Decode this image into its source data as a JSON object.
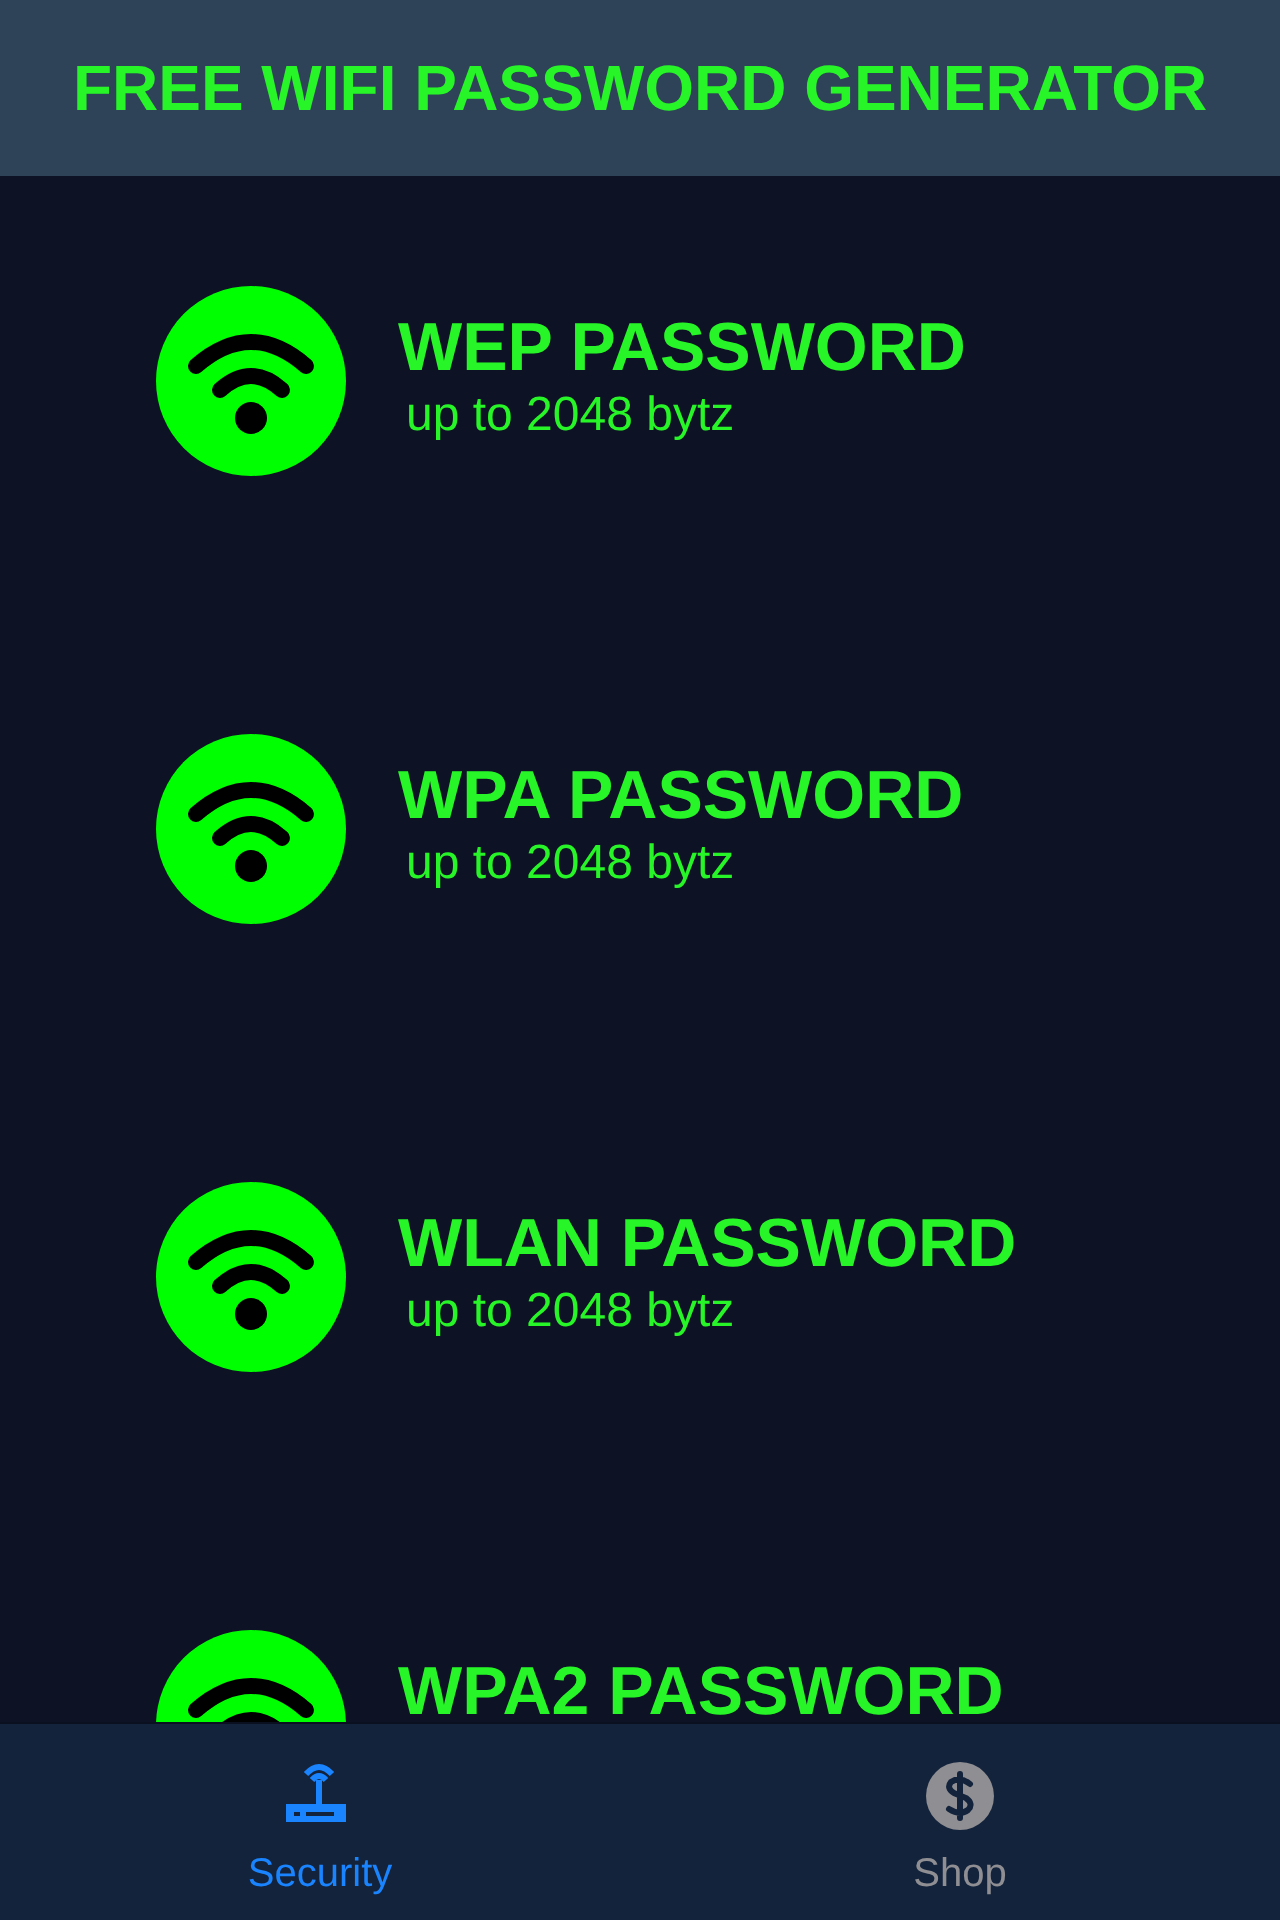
{
  "header": {
    "title": "FREE WIFI PASSWORD GENERATOR"
  },
  "items": [
    {
      "title": "WEP PASSWORD",
      "subtitle": "up to 2048 bytz"
    },
    {
      "title": "WPA PASSWORD",
      "subtitle": "up to 2048 bytz"
    },
    {
      "title": "WLAN PASSWORD",
      "subtitle": "up to 2048 bytz"
    },
    {
      "title": "WPA2 PASSWORD"
    }
  ],
  "tabs": [
    {
      "label": "Security",
      "kind": "router",
      "selected": true
    },
    {
      "label": "Shop",
      "kind": "dollar",
      "selected": false
    }
  ]
}
